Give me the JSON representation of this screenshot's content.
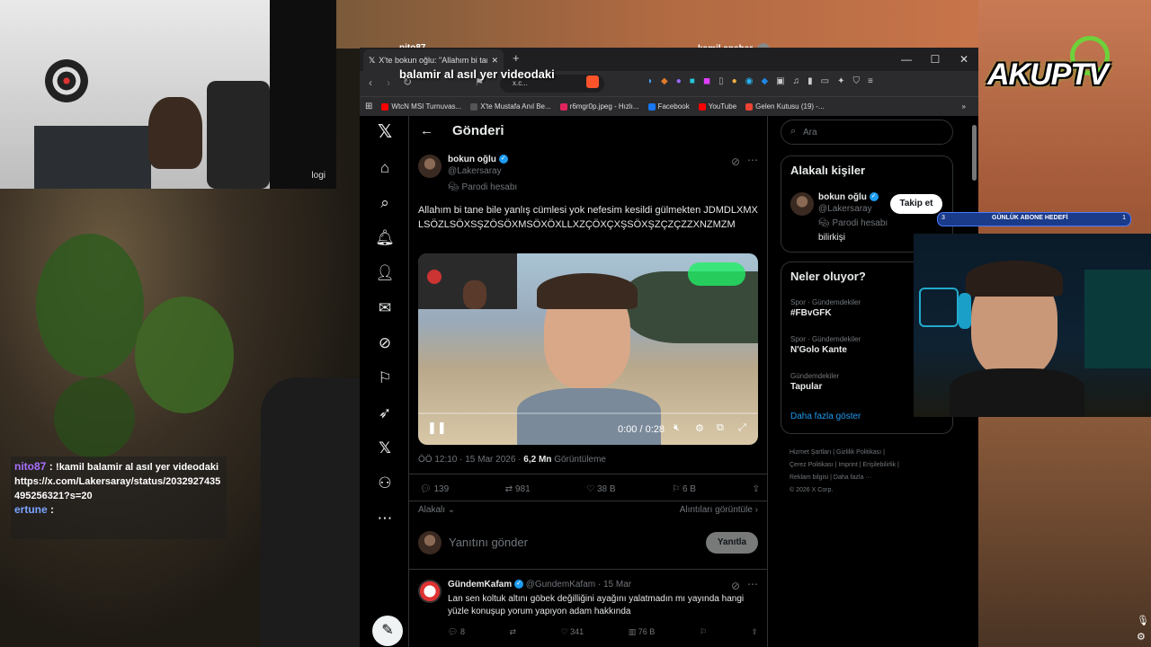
{
  "overlay": {
    "viewer_name": "nito87",
    "streamer_name": "kamil anahar",
    "top_caption": "balamir al asıl yer videodaki",
    "cam_label": "logi",
    "logo_text": "AKUPTV",
    "follow_pill": "Takip et",
    "subgoal": {
      "left": "3",
      "label": "GÜNLÜK ABONE HEDEFİ",
      "right": "1"
    },
    "chat": [
      {
        "user": "nito87",
        "sep": ":",
        "text": "!kamil balamir al asıl yer videodaki https://x.com/Lakersaray/status/2032927435495256321?s=20"
      },
      {
        "user": "ertune",
        "sep": ":",
        "text": ""
      }
    ]
  },
  "browser": {
    "tab_title": "X'te bokun oğlu: \"Allahım bi tane",
    "url": "x.c...",
    "bookmarks": [
      {
        "label": "WtcN MSI Turnuvas...",
        "color": "#ff0000"
      },
      {
        "label": "X'te Mustafa Anıl Be...",
        "color": "#555555"
      },
      {
        "label": "r6mgr0p.jpeg - Hızlı...",
        "color": "#e0245e"
      },
      {
        "label": "Facebook",
        "color": "#1877f2"
      },
      {
        "label": "YouTube",
        "color": "#ff0000"
      },
      {
        "label": "Gelen Kutusu (19) -...",
        "color": "#ea4335"
      }
    ]
  },
  "header": {
    "title": "Gönderi"
  },
  "post": {
    "author": "bokun oğlu",
    "handle": "@Lakersaray",
    "label": "Parodi hesabı",
    "text": "Allahım bi tane bile yanlış cümlesi yok nefesim kesildi gülmekten JDMDLXMXLSÖZLSÖXSŞZÖSÖXMSÖXÖXLLXZÇÖXÇXŞSÖXŞZÇZÇZZXNZMZM",
    "video_time": "0:00 / 0:28",
    "video_progress": 0,
    "meta_time": "ÖÖ 12:10 · 15 Mar 2026 · ",
    "views": "6,2 Mn",
    "views_label": "Görüntüleme",
    "stats": {
      "replies": "139",
      "reposts": "981",
      "likes": "38 B",
      "bookmarks": "6 B"
    },
    "related_label": "Alakalı",
    "quotes_label": "Alıntıları görüntüle",
    "reply_placeholder": "Yanıtını gönder",
    "reply_button": "Yanıtla"
  },
  "reply": {
    "author": "GündemKafam",
    "handle": "@GundemKafam · 15 Mar",
    "text": "Lan sen koltuk altını göbek değilliğini ayağını yalatmadın mı yayında hangi yüzle konuşup yorum yapıyon adam hakkında",
    "stats": {
      "replies": "8",
      "likes": "341",
      "views": "76 B"
    }
  },
  "sidebar": {
    "search_placeholder": "Ara",
    "related_title": "Alakalı kişiler",
    "person": {
      "name": "bokun oğlu",
      "handle": "@Lakersaray",
      "label": "Parodi hesabı",
      "bio": "bilirkişi"
    },
    "trends_title": "Neler oluyor?",
    "trends": [
      {
        "category": "Spor · Gündemdekiler",
        "name": "#FBvGFK"
      },
      {
        "category": "Spor · Gündemdekiler",
        "name": "N'Golo Kante"
      },
      {
        "category": "Gündemdekiler",
        "name": "Tapular"
      }
    ],
    "show_more": "Daha fazla göster",
    "footer": [
      "Hizmet Şartları",
      "Gizlilik Politikası",
      "Çerez Politikası",
      "Imprint",
      "Erişilebilirlik",
      "Reklam bilgisi",
      "Daha fazla ···",
      "© 2026 X Corp."
    ]
  }
}
